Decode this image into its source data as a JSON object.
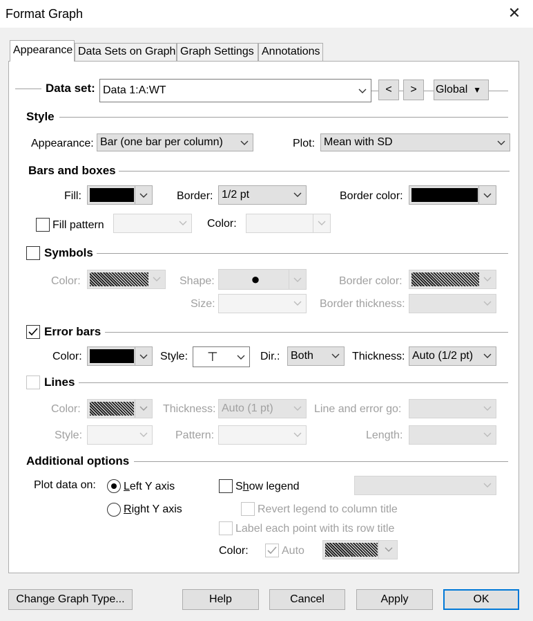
{
  "window": {
    "title": "Format Graph"
  },
  "tabs": [
    {
      "label": "Appearance"
    },
    {
      "label": "Data Sets on Graph"
    },
    {
      "label": "Graph Settings"
    },
    {
      "label": "Annotations"
    }
  ],
  "dataset": {
    "label": "Data set:",
    "value": "Data 1:A:WT",
    "prev_label": "<",
    "next_label": ">",
    "scope_value": "Global"
  },
  "style": {
    "heading": "Style",
    "appearance_label": "Appearance:",
    "appearance_value": "Bar (one bar per column)",
    "plot_label": "Plot:",
    "plot_value": "Mean with SD"
  },
  "bars": {
    "heading": "Bars and boxes",
    "fill_label": "Fill:",
    "fill_color": "#000000",
    "border_label": "Border:",
    "border_value": "1/2 pt",
    "border_color_label": "Border color:",
    "border_color": "#000000",
    "fill_pattern_label": "Fill pattern",
    "fill_pattern_checked": false,
    "color_label": "Color:"
  },
  "symbols": {
    "heading": "Symbols",
    "checked": false,
    "color_label": "Color:",
    "shape_label": "Shape:",
    "shape_glyph": "●",
    "border_color_label": "Border color:",
    "size_label": "Size:",
    "border_thickness_label": "Border thickness:"
  },
  "error_bars": {
    "heading": "Error bars",
    "checked": true,
    "color_label": "Color:",
    "color": "#000000",
    "style_label": "Style:",
    "style_glyph": "⊤",
    "dir_label": "Dir.:",
    "dir_value": "Both",
    "thickness_label": "Thickness:",
    "thickness_value": "Auto (1/2 pt)"
  },
  "lines": {
    "heading": "Lines",
    "checked": false,
    "color_label": "Color:",
    "thickness_label": "Thickness:",
    "thickness_value": "Auto (1 pt)",
    "line_error_label": "Line and error go:",
    "style_label": "Style:",
    "pattern_label": "Pattern:",
    "length_label": "Length:"
  },
  "additional": {
    "heading": "Additional options",
    "plot_on_label": "Plot data on:",
    "left_axis_hotkey": "L",
    "left_axis_rest": "eft Y axis",
    "left_selected": true,
    "right_axis_hotkey": "R",
    "right_axis_rest": "ight  Y axis",
    "show_legend_pre": "S",
    "show_legend_hotkey": "h",
    "show_legend_rest": "ow legend",
    "show_legend_checked": false,
    "revert_legend_label": "Revert legend to column title",
    "label_point_label": "Label each point with its row title",
    "color_label": "Color:",
    "auto_label": "Auto",
    "auto_checked": true
  },
  "footer": {
    "change_type_label": "Change Graph Type...",
    "help_label": "Help",
    "cancel_label": "Cancel",
    "apply_label": "Apply",
    "ok_label": "OK"
  },
  "colors": {
    "accent": "#0078d7",
    "panel": "#ffffff",
    "window": "#f0f0f0"
  }
}
